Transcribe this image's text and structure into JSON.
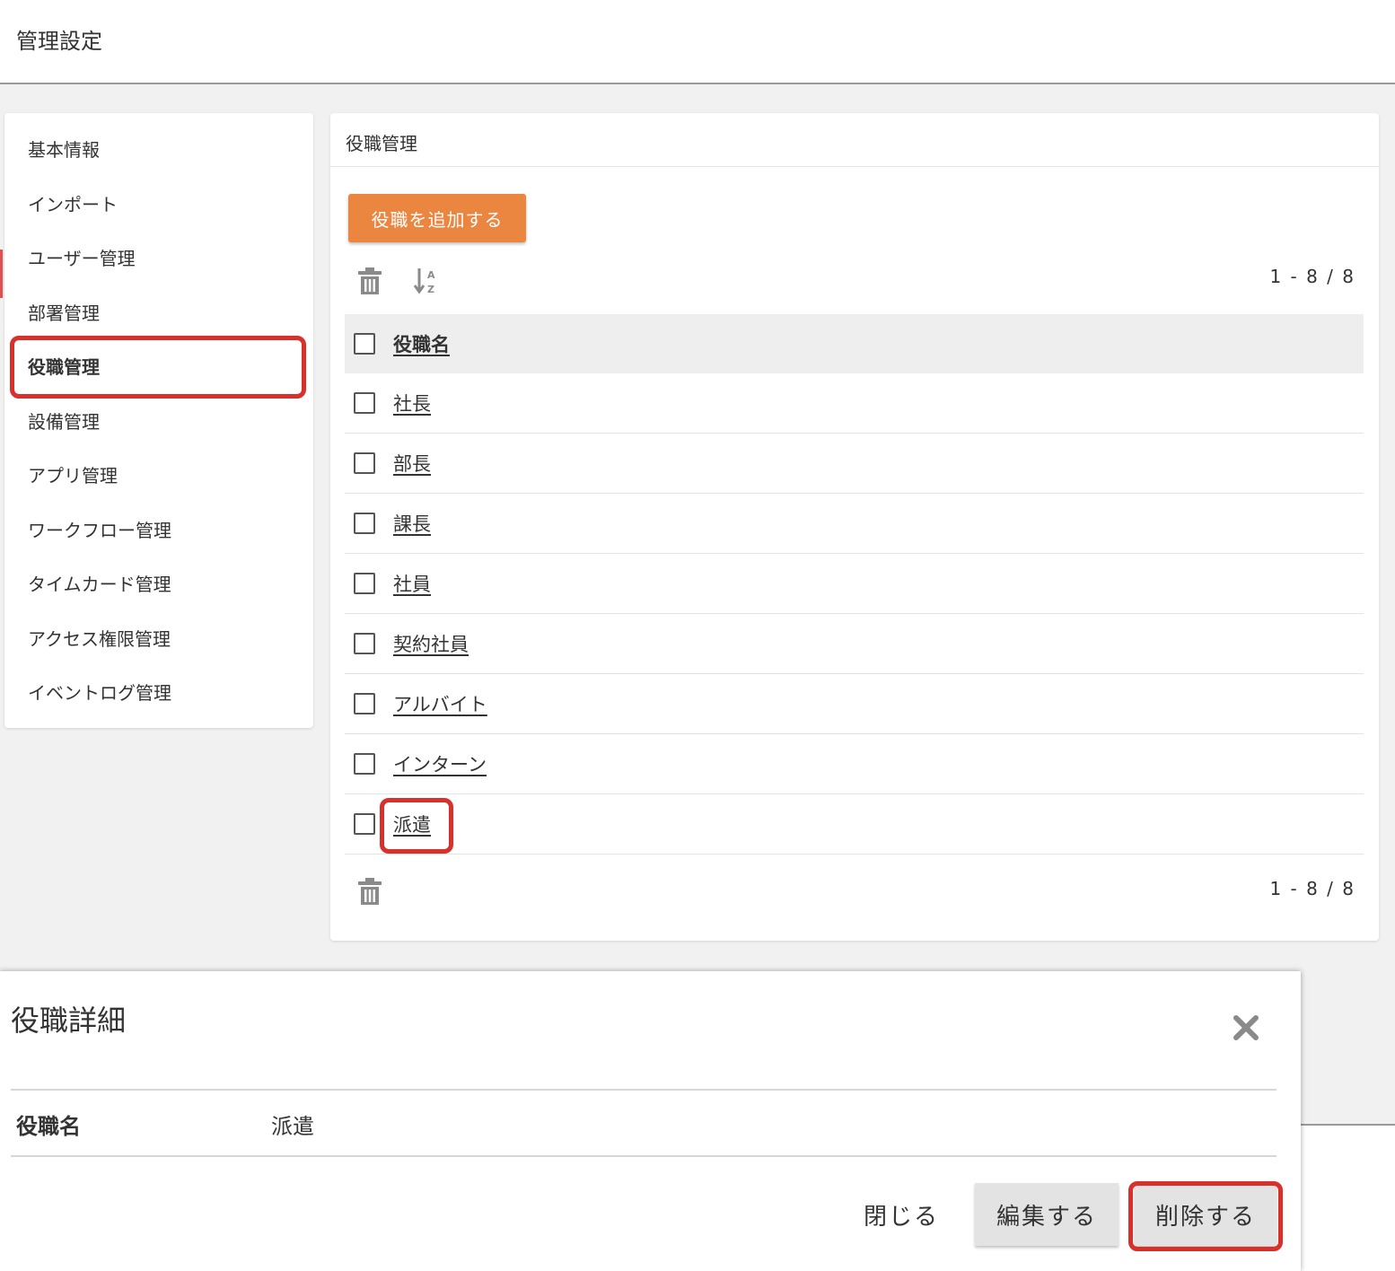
{
  "header": {
    "title": "管理設定"
  },
  "sidebar": {
    "items": [
      {
        "label": "基本情報"
      },
      {
        "label": "インポート"
      },
      {
        "label": "ユーザー管理"
      },
      {
        "label": "部署管理"
      },
      {
        "label": "役職管理",
        "active": true
      },
      {
        "label": "設備管理"
      },
      {
        "label": "アプリ管理"
      },
      {
        "label": "ワークフロー管理"
      },
      {
        "label": "タイムカード管理"
      },
      {
        "label": "アクセス権限管理"
      },
      {
        "label": "イベントログ管理"
      }
    ]
  },
  "panel": {
    "title": "役職管理",
    "add_button_label": "役職を追加する",
    "paging_top": "1 - 8 / 8",
    "paging_bottom": "1 - 8 / 8",
    "column_header": "役職名",
    "rows": [
      "社長",
      "部長",
      "課長",
      "社員",
      "契約社員",
      "アルバイト",
      "インターン",
      "派遣"
    ],
    "icons": {
      "delete": "trash-icon",
      "sort": "sort-alpha-icon"
    }
  },
  "modal": {
    "title": "役職詳細",
    "field_label": "役職名",
    "field_value": "派遣",
    "close_button_label": "閉じる",
    "edit_button_label": "編集する",
    "delete_button_label": "削除する",
    "close_icon": "close-icon"
  },
  "colors": {
    "accent": "#ea863f",
    "highlight": "#d8302b",
    "background": "#f1f1f1"
  }
}
